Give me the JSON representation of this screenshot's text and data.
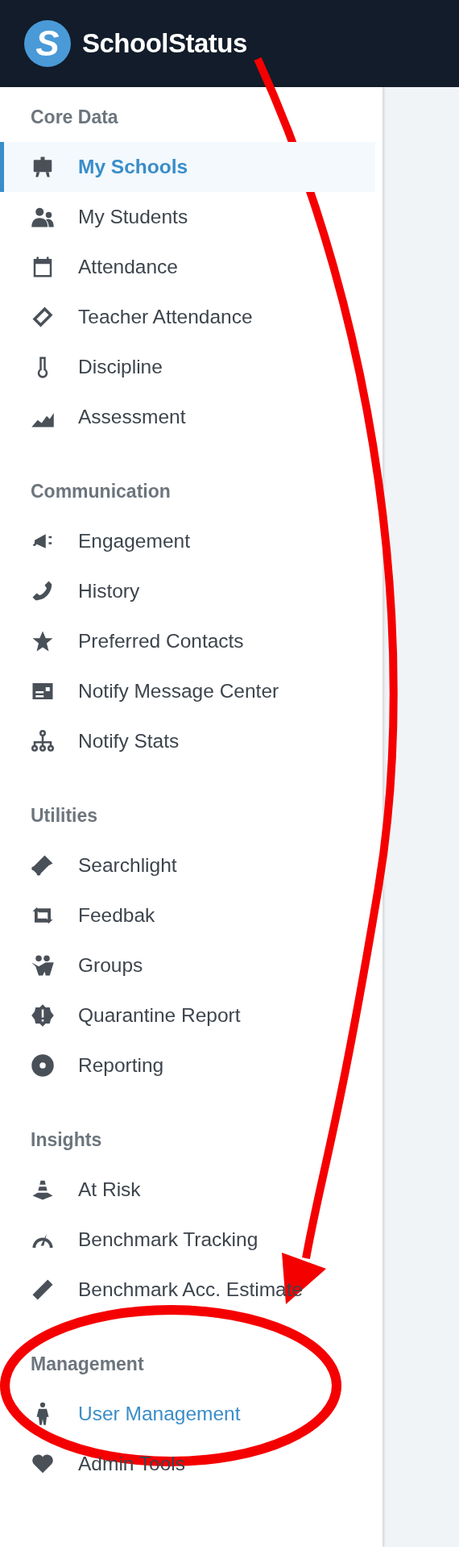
{
  "header": {
    "logo_mark": "S",
    "title": "SchoolStatus"
  },
  "sidebar": {
    "sections": [
      {
        "title": "Core Data",
        "items": [
          {
            "label": "My Schools",
            "selected": true,
            "highlighted": false
          },
          {
            "label": "My Students",
            "selected": false,
            "highlighted": false
          },
          {
            "label": "Attendance",
            "selected": false,
            "highlighted": false
          },
          {
            "label": "Teacher Attendance",
            "selected": false,
            "highlighted": false
          },
          {
            "label": "Discipline",
            "selected": false,
            "highlighted": false
          },
          {
            "label": "Assessment",
            "selected": false,
            "highlighted": false
          }
        ]
      },
      {
        "title": "Communication",
        "items": [
          {
            "label": "Engagement",
            "selected": false,
            "highlighted": false
          },
          {
            "label": "History",
            "selected": false,
            "highlighted": false
          },
          {
            "label": "Preferred Contacts",
            "selected": false,
            "highlighted": false
          },
          {
            "label": "Notify Message Center",
            "selected": false,
            "highlighted": false
          },
          {
            "label": "Notify Stats",
            "selected": false,
            "highlighted": false
          }
        ]
      },
      {
        "title": "Utilities",
        "items": [
          {
            "label": "Searchlight",
            "selected": false,
            "highlighted": false
          },
          {
            "label": "Feedbak",
            "selected": false,
            "highlighted": false
          },
          {
            "label": "Groups",
            "selected": false,
            "highlighted": false
          },
          {
            "label": "Quarantine Report",
            "selected": false,
            "highlighted": false
          },
          {
            "label": "Reporting",
            "selected": false,
            "highlighted": false
          }
        ]
      },
      {
        "title": "Insights",
        "items": [
          {
            "label": "At Risk",
            "selected": false,
            "highlighted": false
          },
          {
            "label": "Benchmark Tracking",
            "selected": false,
            "highlighted": false
          },
          {
            "label": "Benchmark Acc. Estimate",
            "selected": false,
            "highlighted": false
          }
        ]
      },
      {
        "title": "Management",
        "items": [
          {
            "label": "User Management",
            "selected": false,
            "highlighted": true
          },
          {
            "label": "Admin Tools",
            "selected": false,
            "highlighted": false
          }
        ]
      }
    ]
  },
  "annotations": [
    {
      "kind": "arrow"
    },
    {
      "kind": "ellipse"
    }
  ]
}
